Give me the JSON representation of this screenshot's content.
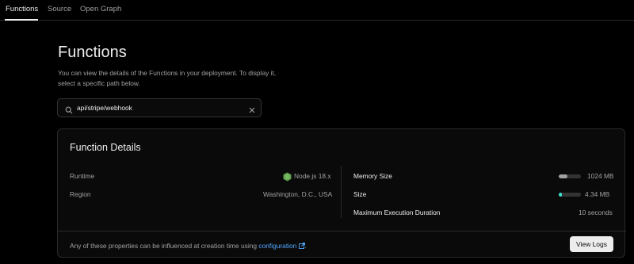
{
  "tabs": [
    {
      "label": "Functions",
      "active": true
    },
    {
      "label": "Source",
      "active": false
    },
    {
      "label": "Open Graph",
      "active": false
    }
  ],
  "page": {
    "title": "Functions",
    "description": "You can view the details of the Functions in your deployment. To display it, select a specific path below."
  },
  "search": {
    "value": "api/stripe/webhook",
    "icon": "search-icon",
    "clear_icon": "close-icon"
  },
  "details": {
    "title": "Function Details",
    "left": [
      {
        "label": "Runtime",
        "value": "Node.js 18.x",
        "icon": "nodejs-icon"
      },
      {
        "label": "Region",
        "value": "Washington, D.C., USA"
      }
    ],
    "right": [
      {
        "label": "Memory Size",
        "value": "1024 MB",
        "usage_fraction": 0.4,
        "bar_color": "#a1a1a1"
      },
      {
        "label": "Size",
        "value": "4.34 MB",
        "usage_fraction": 0.15,
        "bar_color": "#3ee0d0"
      },
      {
        "label": "Maximum Execution Duration",
        "value": "10 seconds"
      }
    ],
    "footer": {
      "text": "Any of these properties can be influenced at creation time using",
      "link": "configuration",
      "link_suffix": ".",
      "button": "View Logs"
    }
  },
  "colors": {
    "background": "#000000",
    "accent_link": "#52a8ff",
    "node_green": "#5fa04e"
  }
}
